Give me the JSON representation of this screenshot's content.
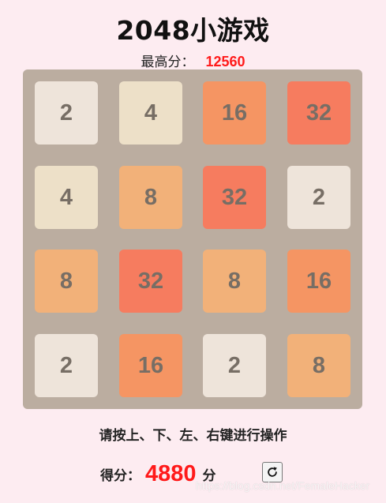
{
  "title": "2048小游戏",
  "best": {
    "label": "最高分：",
    "value": "12560"
  },
  "board": {
    "rows": [
      [
        "2",
        "4",
        "16",
        "32"
      ],
      [
        "4",
        "8",
        "32",
        "2"
      ],
      [
        "8",
        "32",
        "8",
        "16"
      ],
      [
        "2",
        "16",
        "2",
        "8"
      ]
    ]
  },
  "tile_colors": {
    "2": "#eee4da",
    "4": "#ede0c8",
    "8": "#f2b179",
    "16": "#f59563",
    "32": "#f67c5f"
  },
  "hint": "请按上、下、左、右键进行操作",
  "score": {
    "label": "得分：",
    "value": "4880",
    "unit": "分"
  },
  "restart_icon": "refresh-icon",
  "watermark": "https://blog.csdn.net/FemaleHacker"
}
